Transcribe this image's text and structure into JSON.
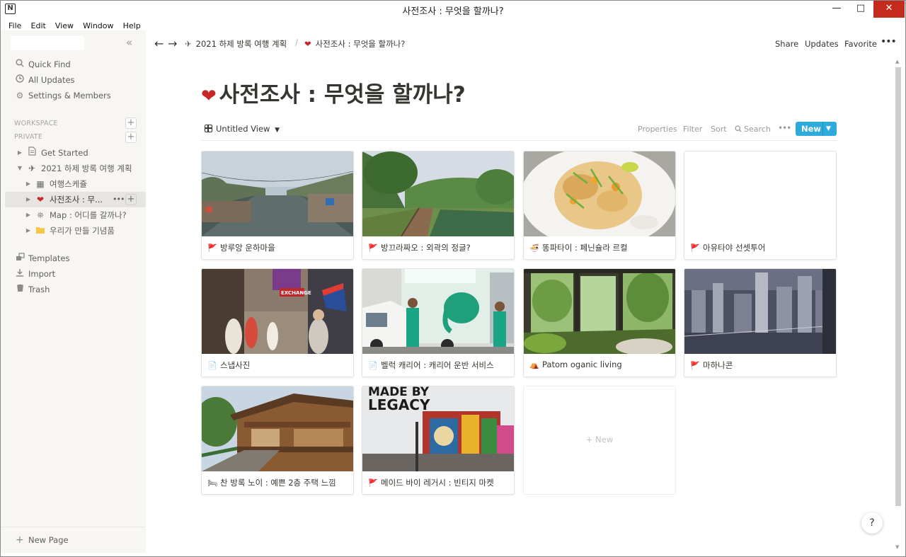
{
  "window": {
    "title": "사전조사 : 무엇을 할까나?",
    "app_icon": "N"
  },
  "menu": [
    "File",
    "Edit",
    "View",
    "Window",
    "Help"
  ],
  "sidebar": {
    "nav": [
      {
        "label": "Quick Find",
        "icon": "search-icon"
      },
      {
        "label": "All Updates",
        "icon": "clock-icon"
      },
      {
        "label": "Settings & Members",
        "icon": "gear-icon"
      }
    ],
    "workspace_label": "WORKSPACE",
    "private_label": "PRIVATE",
    "tree": [
      {
        "label": "Get Started",
        "icon": "📄"
      },
      {
        "label": "2021 하제 방록 여행 계획",
        "icon": "✈"
      },
      {
        "label": "여행스케쥴",
        "icon": "▦"
      },
      {
        "label": "사전조사 : 무...",
        "icon": "❤"
      },
      {
        "label": "Map : 어디를 갈까나?",
        "icon": "⛯"
      },
      {
        "label": "우리가 만들 기념품",
        "icon": "📁"
      }
    ],
    "bottom_nav": [
      {
        "label": "Templates",
        "icon": "templates-icon"
      },
      {
        "label": "Import",
        "icon": "download-icon"
      },
      {
        "label": "Trash",
        "icon": "trash-icon"
      }
    ],
    "new_page": "New Page"
  },
  "topbar": {
    "breadcrumb": [
      "2021 하제 방록 여행 계획",
      "사전조사 : 무엇을 할까나?"
    ],
    "share": "Share",
    "updates": "Updates",
    "favorite": "Favorite"
  },
  "page": {
    "title": "사전조사 : 무엇을 할까나?",
    "view_name": "Untitled View",
    "properties": "Properties",
    "filter": "Filter",
    "sort": "Sort",
    "search": "Search",
    "new": "New"
  },
  "cards": [
    {
      "title": "방루앙 운하마을",
      "icon": "🚩"
    },
    {
      "title": "방끄라짜오 : 외곽의 정글?",
      "icon": "🚩"
    },
    {
      "title": "똥파타이 : 페닌슐라 르컬",
      "icon": "🍜"
    },
    {
      "title": "아유타야 선셋투어",
      "icon": "🚩"
    },
    {
      "title": "스냅사진",
      "icon": "📄"
    },
    {
      "title": "벨럭 캐리어 : 캐리어 운반 서비스",
      "icon": "📄"
    },
    {
      "title": "Patom oganic living",
      "icon": "⛺"
    },
    {
      "title": "마하나콘",
      "icon": "🚩"
    },
    {
      "title": "찬 방록 노이 : 예쁜 2층 주택 느낌",
      "icon": "🛏"
    },
    {
      "title": "메이드 바이 레거시 : 빈티지 마켓",
      "icon": "🚩"
    }
  ],
  "card_cover_texts": {
    "legacy_line1": "MADE BY",
    "legacy_line2": "LEGACY",
    "exchange_sign": "EXCHANGE"
  },
  "new_card_label": "+ New",
  "help": "?",
  "colors": {
    "accent": "#2eaadc",
    "sidebar_bg": "#f7f6f3",
    "text": "#37352f"
  }
}
